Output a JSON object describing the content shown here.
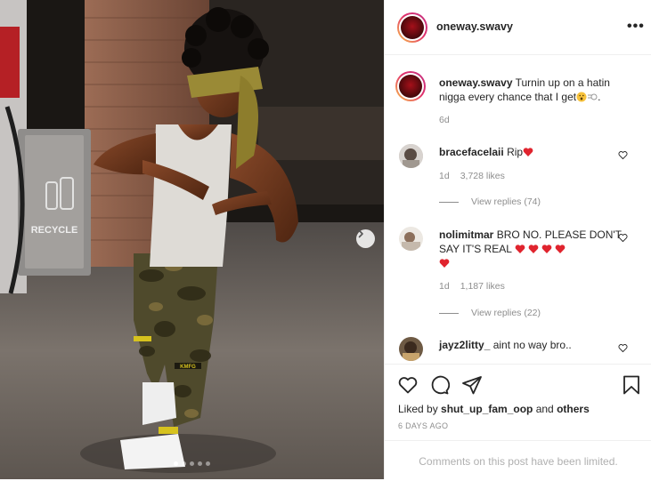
{
  "post": {
    "username": "oneway.swavy",
    "more_label": "•••",
    "caption_user": "oneway.swavy",
    "caption_text": "Turnin up on a hatin nigga every chance that I get",
    "caption_age": "6d",
    "photo_text": "RECYCLE",
    "pants_text": "KMFG",
    "carousel_dots": 5,
    "carousel_active": 0
  },
  "comments": [
    {
      "user": "bracefacelaii",
      "text": "Rip",
      "age": "1d",
      "likes": "3,728 likes",
      "replies": "View replies (74)"
    },
    {
      "user": "nolimitmar",
      "text": "BRO NO. PLEASE DON'T SAY IT'S REAL",
      "age": "1d",
      "likes": "1,187 likes",
      "replies": "View replies (22)"
    },
    {
      "user": "jayz2litty_",
      "text": "aint no way bro.."
    }
  ],
  "footer": {
    "liked_prefix": "Liked by ",
    "liked_user": "shut_up_fam_oop",
    "liked_mid": " and ",
    "liked_others": "others",
    "date": "6 DAYS AGO",
    "comments_limited": "Comments on this post have been limited."
  },
  "colors": {
    "heart_red": "#e0242e",
    "muted": "#8e8e8e",
    "border": "#efefef"
  },
  "icons": [
    "heart-icon",
    "comment-icon",
    "share-icon",
    "bookmark-icon",
    "chevron-right-icon",
    "more-icon"
  ]
}
